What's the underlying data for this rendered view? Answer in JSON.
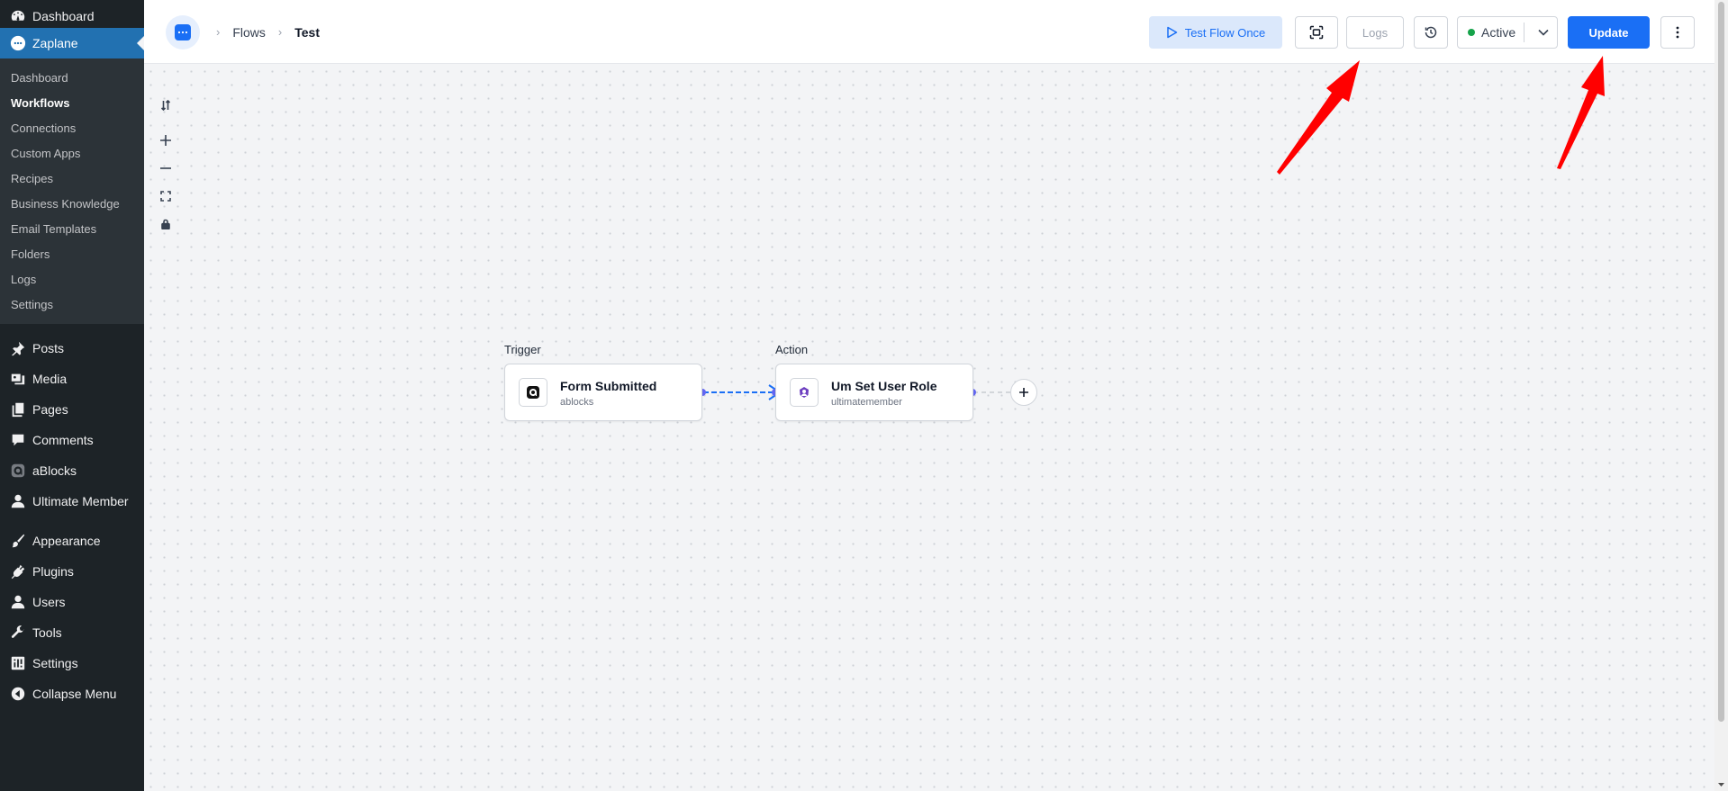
{
  "sidebar": {
    "top_items": [
      {
        "label": "Dashboard",
        "icon": "dashboard-icon"
      },
      {
        "label": "Zaplane",
        "icon": "zaplane-icon",
        "current": true
      }
    ],
    "zaplane_submenu": [
      {
        "label": "Dashboard"
      },
      {
        "label": "Workflows",
        "active": true
      },
      {
        "label": "Connections"
      },
      {
        "label": "Custom Apps"
      },
      {
        "label": "Recipes"
      },
      {
        "label": "Business Knowledge"
      },
      {
        "label": "Email Templates"
      },
      {
        "label": "Folders"
      },
      {
        "label": "Logs"
      },
      {
        "label": "Settings"
      }
    ],
    "menu_items": [
      {
        "label": "Posts",
        "icon": "pin-icon"
      },
      {
        "label": "Media",
        "icon": "media-icon"
      },
      {
        "label": "Pages",
        "icon": "pages-icon"
      },
      {
        "label": "Comments",
        "icon": "comments-icon"
      },
      {
        "label": "aBlocks",
        "icon": "ablocks-icon"
      },
      {
        "label": "Ultimate Member",
        "icon": "user-icon"
      },
      {
        "label": "Appearance",
        "icon": "brush-icon"
      },
      {
        "label": "Plugins",
        "icon": "plugin-icon"
      },
      {
        "label": "Users",
        "icon": "users-icon"
      },
      {
        "label": "Tools",
        "icon": "wrench-icon"
      },
      {
        "label": "Settings",
        "icon": "settings-icon"
      },
      {
        "label": "Collapse Menu",
        "icon": "collapse-icon"
      }
    ]
  },
  "header": {
    "breadcrumb": [
      "Flows",
      "Test"
    ],
    "test_button_label": "Test Flow Once",
    "logs_button_label": "Logs",
    "status_label": "Active",
    "status_color": "#16a34a",
    "update_button_label": "Update"
  },
  "flow": {
    "trigger": {
      "section_label": "Trigger",
      "title": "Form Submitted",
      "subtitle": "ablocks"
    },
    "action": {
      "section_label": "Action",
      "title": "Um Set User Role",
      "subtitle": "ultimatemember"
    }
  },
  "colors": {
    "wp_sidebar": "#1d2327",
    "wp_highlight": "#2271b1",
    "accent": "#1a6ff5",
    "annotation_arrow": "#ff0000"
  }
}
